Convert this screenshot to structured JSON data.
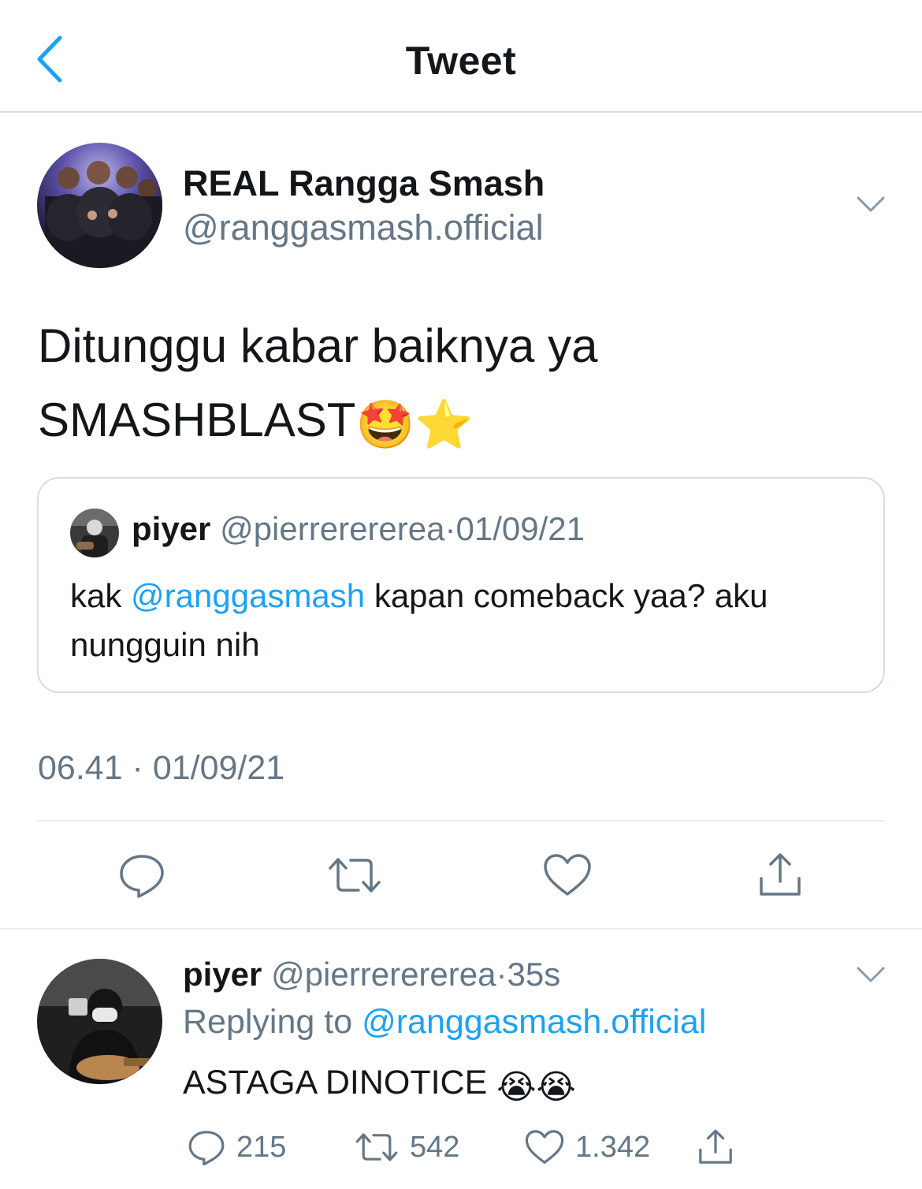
{
  "nav": {
    "title": "Tweet"
  },
  "tweet": {
    "author_name": "REAL Rangga Smash",
    "author_handle": "@ranggasmash.official",
    "text_line1": "Ditunggu kabar baiknya ya",
    "text_line2": "SMASHBLAST",
    "emojis": [
      "🤩",
      "⭐"
    ],
    "timestamp": "06.41 · 01/09/21"
  },
  "quote": {
    "name": "piyer",
    "handle": "@pierrerererea",
    "dot": "·",
    "date": "01/09/21",
    "text_prefix": "kak ",
    "mention": "@ranggasmash",
    "text_suffix": " kapan comeback yaa? aku nungguin nih"
  },
  "reply": {
    "name": "piyer",
    "handle": "@pierrerererea",
    "dot": "·",
    "time": "35s",
    "replying_label": "Replying to ",
    "replying_to": "@ranggasmash.official",
    "text": "ASTAGA DINOTICE ",
    "emojis": [
      "😭",
      "😭"
    ],
    "stats": {
      "replies": "215",
      "retweets": "542",
      "likes": "1.342"
    }
  },
  "icons": [
    "back-chevron-icon",
    "chevron-down-icon",
    "reply-icon",
    "retweet-icon",
    "like-icon",
    "share-icon"
  ],
  "colors": {
    "accent": "#1da1f2",
    "muted": "#657786",
    "text": "#14171a",
    "border": "#d7dce2"
  }
}
